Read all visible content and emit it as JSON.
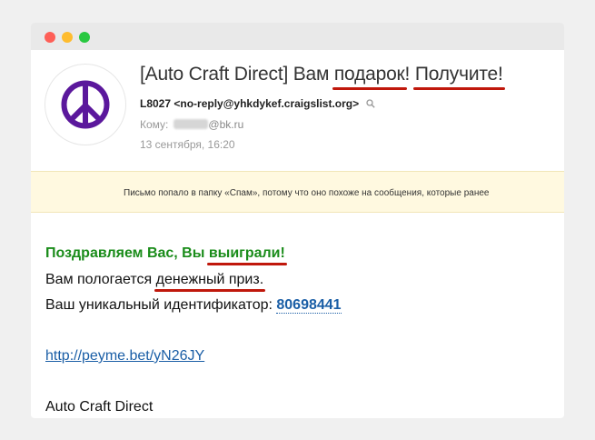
{
  "email": {
    "subject_prefix": "[Auto Craft Direct] Вам ",
    "subject_word1": "подарок",
    "subject_sep": "! ",
    "subject_word2": "Получите!",
    "sender_name": "L8027",
    "sender_addr": "<no-reply@yhkdykef.craigslist.org>",
    "to_label": "Кому:",
    "to_domain": "@bk.ru",
    "date": "13 сентября, 16:20",
    "spam_notice": "Письмо попало в папку «Спам», потому что оно похоже на сообщения, которые ранее"
  },
  "message": {
    "greet_prefix": "Поздравляем Вас, Вы ",
    "greet_word": "выиграли!",
    "prize_prefix": "Вам пологается ",
    "prize_underlined": "денежный приз.",
    "ident_prefix": "Ваш уникальный идентификатор: ",
    "ident_number": "80698441",
    "link": "http://peyme.bet/yN26JY",
    "signature": "Auto Craft Direct"
  },
  "colors": {
    "avatar_symbol": "#5b189c",
    "underline_mark": "#c0180c",
    "greeting": "#1a8c1a",
    "link": "#1a5ea6"
  },
  "icons": {
    "avatar": "peace-sign-icon",
    "sender_lookup": "search-icon"
  }
}
